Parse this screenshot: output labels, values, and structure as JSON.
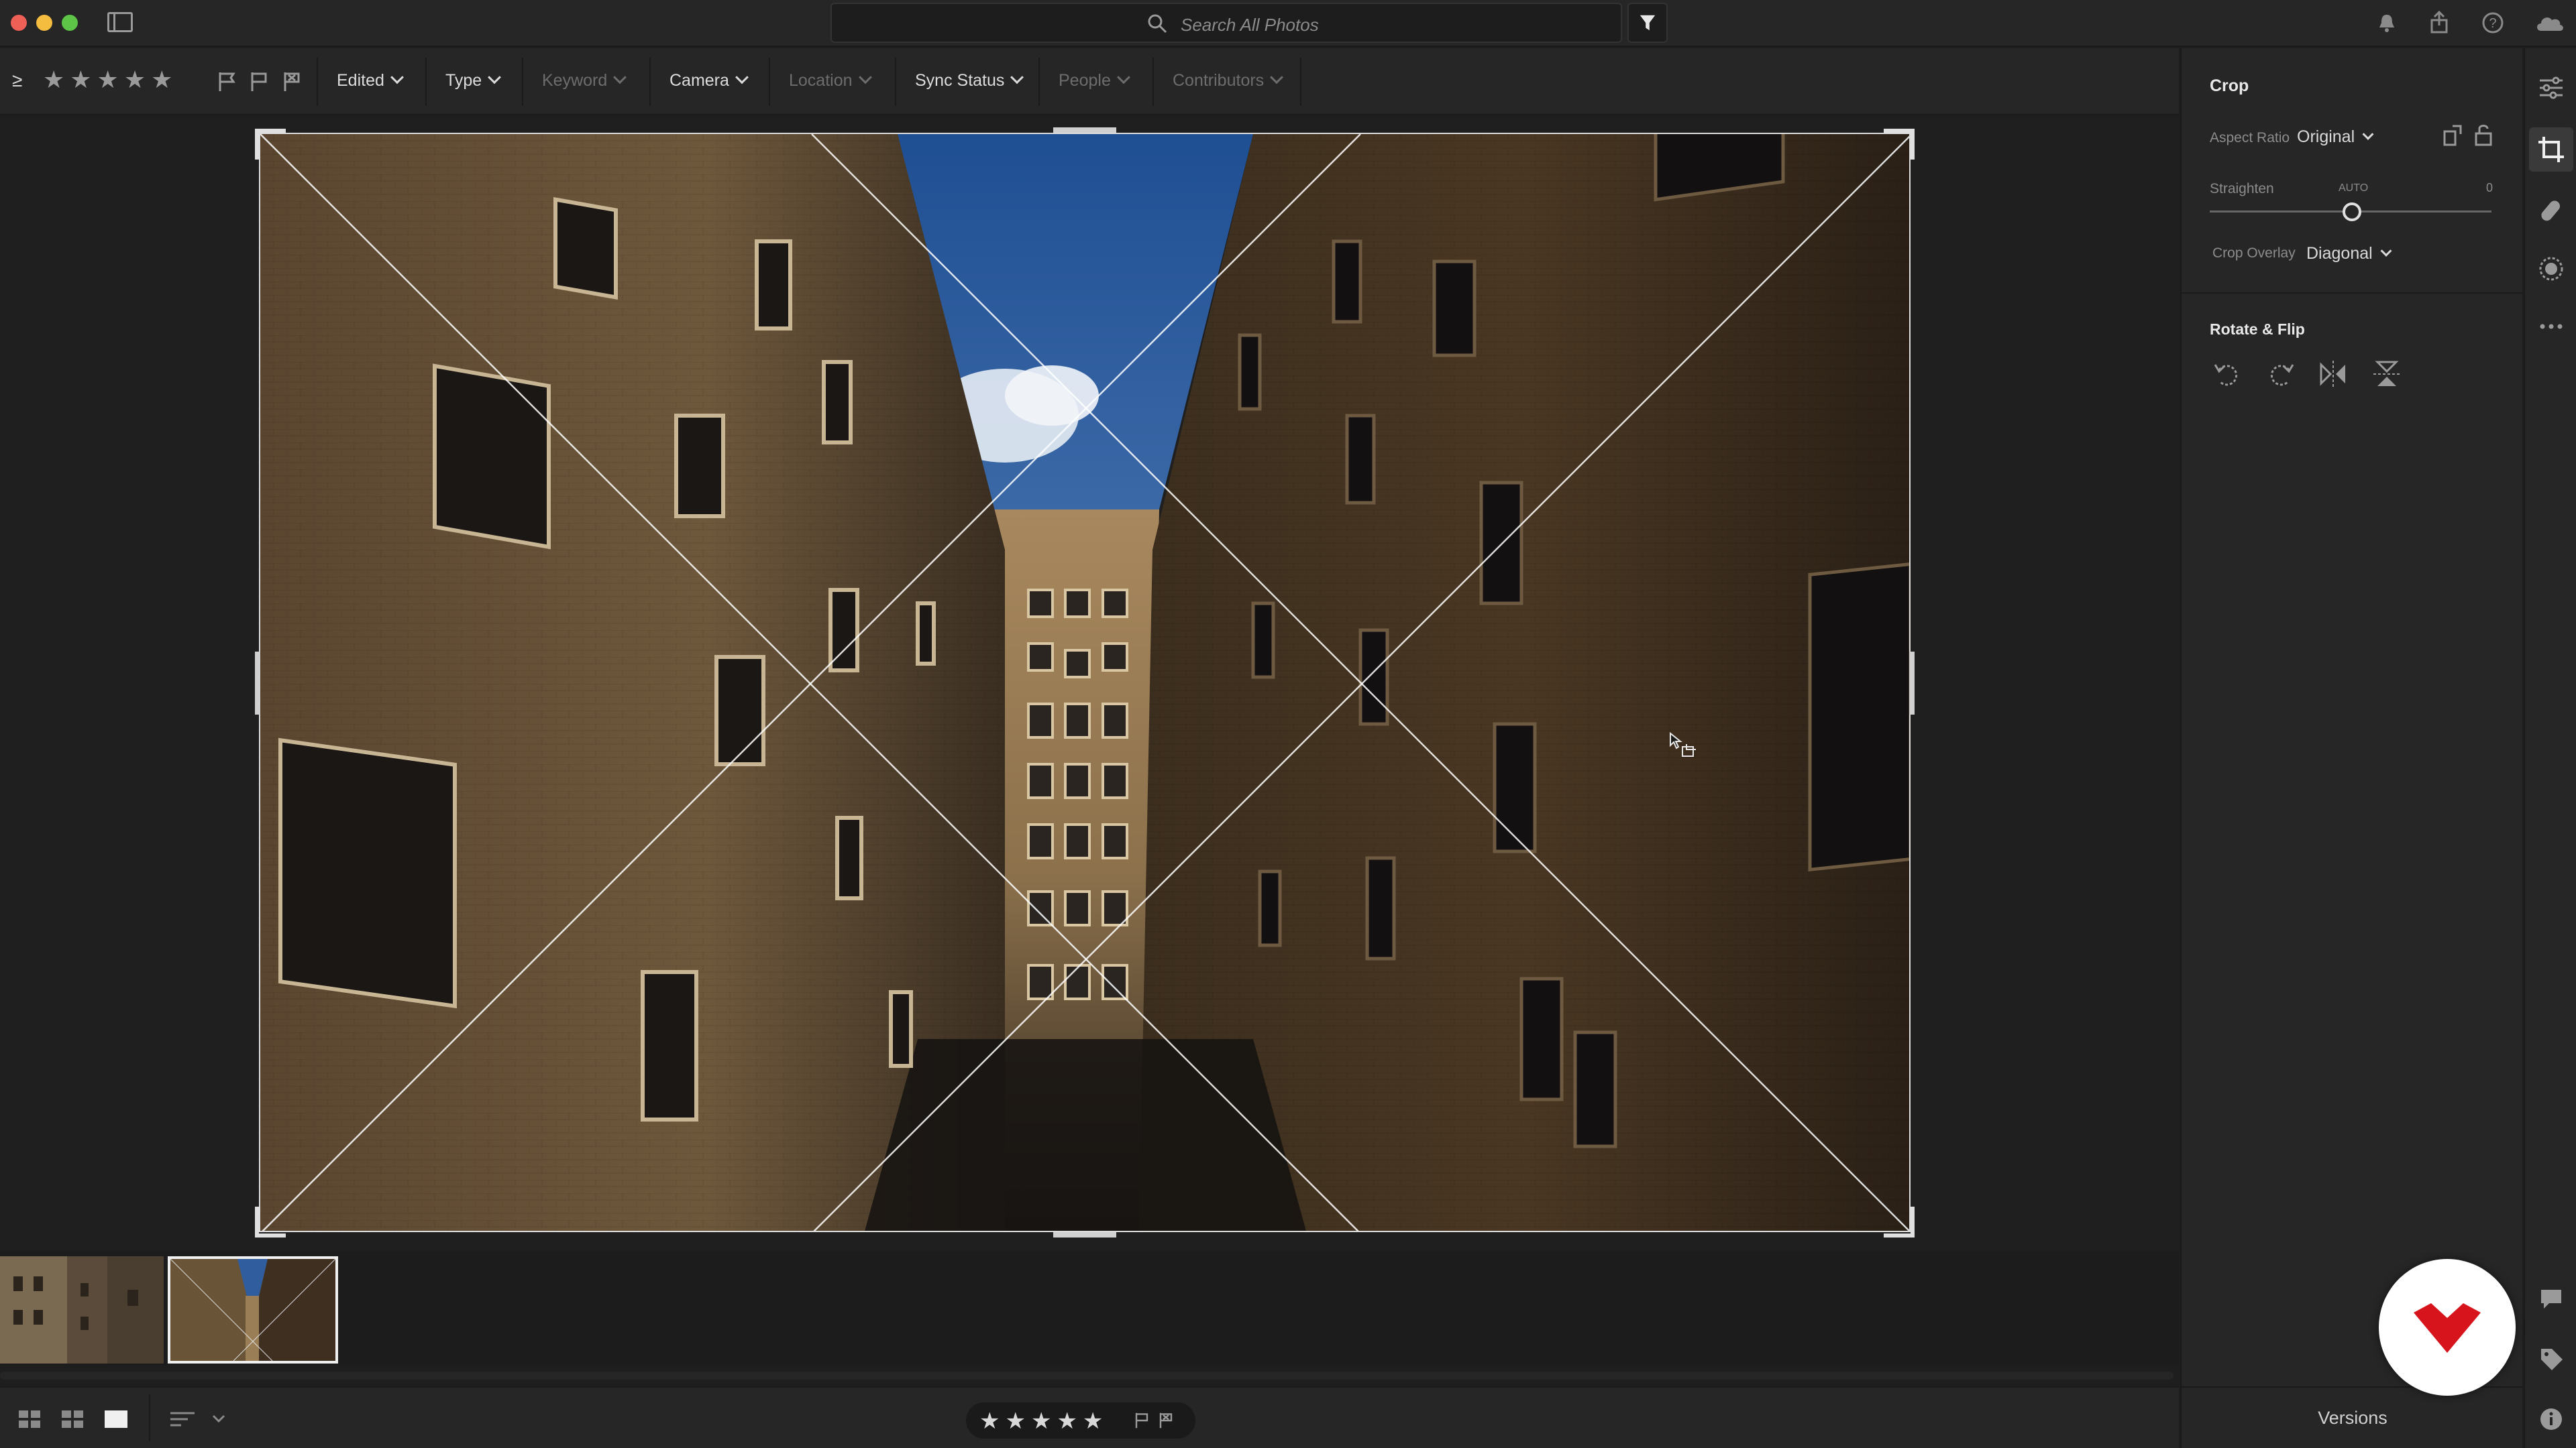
{
  "search": {
    "placeholder": "Search All Photos"
  },
  "filter_bar": {
    "ge_symbol": "≥",
    "stars": "★★★★★",
    "items": [
      {
        "label": "Edited",
        "enabled": true
      },
      {
        "label": "Type",
        "enabled": true
      },
      {
        "label": "Keyword",
        "enabled": false
      },
      {
        "label": "Camera",
        "enabled": true
      },
      {
        "label": "Location",
        "enabled": false
      },
      {
        "label": "Sync Status",
        "enabled": true
      },
      {
        "label": "People",
        "enabled": false
      },
      {
        "label": "Contributors",
        "enabled": false
      }
    ]
  },
  "crop_panel": {
    "title": "Crop",
    "aspect_ratio_label": "Aspect Ratio",
    "aspect_ratio_value": "Original",
    "straighten_label": "Straighten",
    "straighten_auto": "AUTO",
    "straighten_value": "0",
    "crop_overlay_label": "Crop Overlay",
    "crop_overlay_value": "Diagonal"
  },
  "rotate_flip": {
    "title": "Rotate & Flip"
  },
  "versions_label": "Versions",
  "bottom_rating": {
    "stars": "★★★★★"
  },
  "colors": {
    "panel_bg": "#262626",
    "canvas_bg": "#1f1f1f",
    "accent_red": "#d7141c",
    "sky": "#2f5d9e"
  }
}
